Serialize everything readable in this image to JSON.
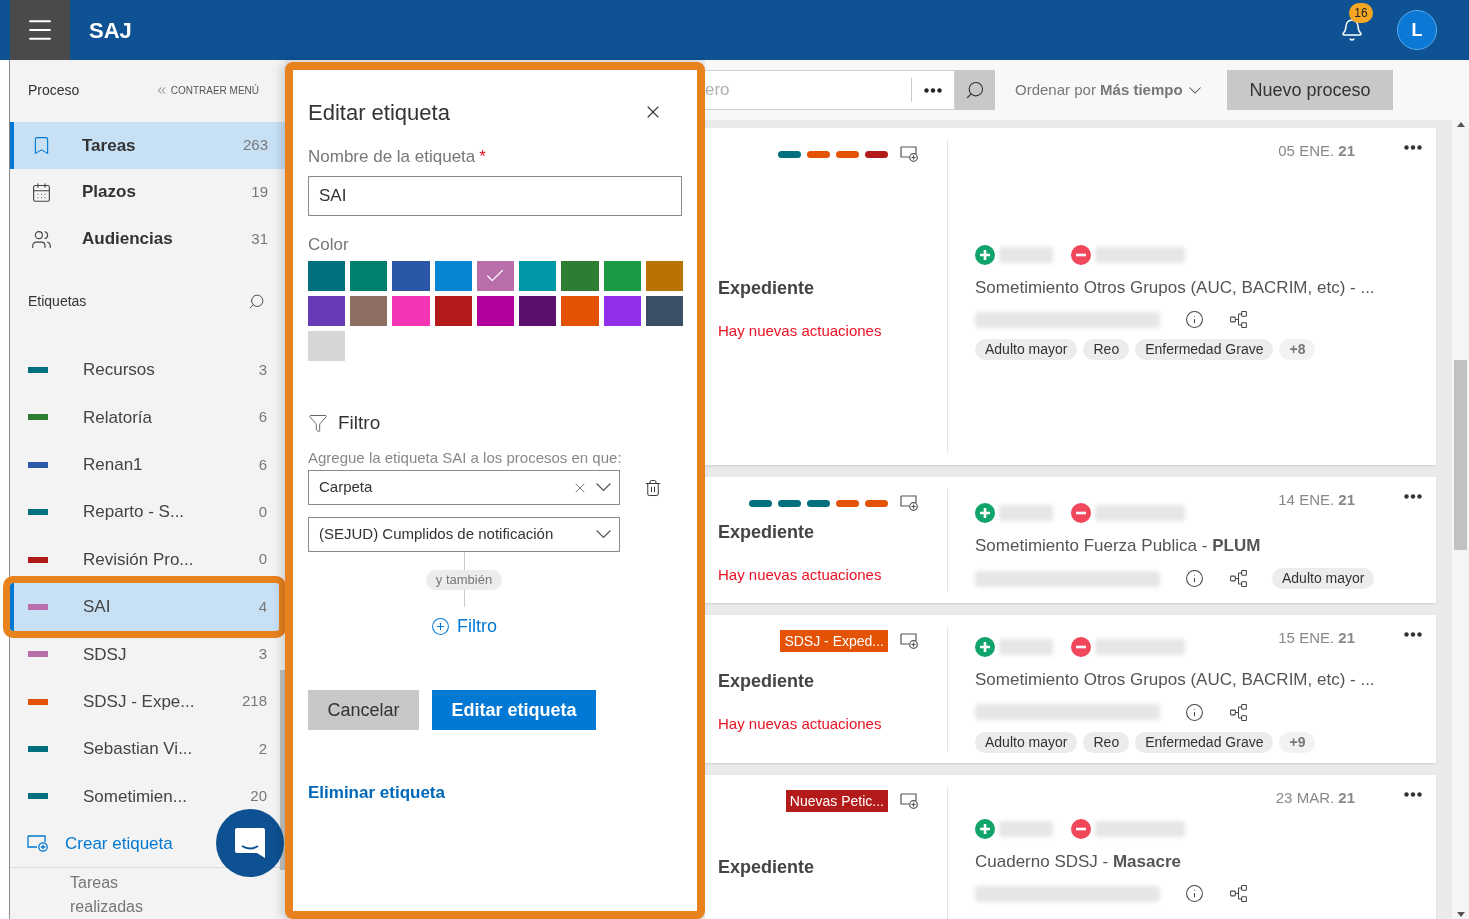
{
  "header": {
    "app_name": "SAJ",
    "notifications": "16",
    "avatar": "L"
  },
  "sidebar": {
    "section_title": "Proceso",
    "collapse": "CONTRAER MENÚ",
    "nav": [
      {
        "label": "Tareas",
        "count": "263",
        "selected": true
      },
      {
        "label": "Plazos",
        "count": "19",
        "selected": false
      },
      {
        "label": "Audiencias",
        "count": "31",
        "selected": false
      }
    ],
    "labels_title": "Etiquetas",
    "labels": [
      {
        "name": "Recursos",
        "count": "3",
        "color": "#00707f",
        "selected": false,
        "annotated": false
      },
      {
        "name": "Relatoría",
        "count": "6",
        "color": "#2e7d32",
        "selected": false,
        "annotated": false
      },
      {
        "name": "Renan1",
        "count": "6",
        "color": "#2b58a6",
        "selected": false,
        "annotated": false
      },
      {
        "name": "Reparto - S...",
        "count": "0",
        "color": "#00707f",
        "selected": false,
        "annotated": false
      },
      {
        "name": "Revisión Pro...",
        "count": "0",
        "color": "#b31b1b",
        "selected": false,
        "annotated": false
      },
      {
        "name": "SAI",
        "count": "4",
        "color": "#b86eab",
        "selected": true,
        "annotated": true
      },
      {
        "name": "SDSJ",
        "count": "3",
        "color": "#b86eab",
        "selected": false,
        "annotated": false
      },
      {
        "name": "SDSJ - Expe...",
        "count": "218",
        "color": "#e35205",
        "selected": false,
        "annotated": false
      },
      {
        "name": "Sebastian Vi...",
        "count": "2",
        "color": "#00707f",
        "selected": false,
        "annotated": false
      },
      {
        "name": "Sometimien...",
        "count": "20",
        "color": "#00707f",
        "selected": false,
        "annotated": false
      }
    ],
    "create_label": "Crear etiqueta",
    "footer": "Tareas realizadas"
  },
  "toolbar": {
    "search_placeholder": "ero",
    "sort": "Ordenar por **Más tiempo**",
    "new_process": "Nuevo proceso"
  },
  "cards": [
    {
      "tags": [
        {
          "color": "#00707f"
        },
        {
          "color": "#e35205"
        },
        {
          "color": "#e35205"
        },
        {
          "color": "#b31b1b"
        }
      ],
      "folder": "Expediente",
      "notice": "Hay nuevas actuaciones",
      "date": "05 ENE. **21**",
      "title": "Sometimiento Otros Grupos (AUC, BACRIM, etc) - ...",
      "chips_inline": false,
      "chips": [
        "Adulto mayor",
        "Reo",
        "Enfermedad Grave"
      ],
      "more": "+8"
    },
    {
      "tags": [
        {
          "color": "#00707f"
        },
        {
          "color": "#00707f"
        },
        {
          "color": "#00707f"
        },
        {
          "color": "#e35205"
        },
        {
          "color": "#e35205"
        }
      ],
      "folder": "Expediente",
      "notice": "Hay nuevas actuaciones",
      "date": "14 ENE. **21**",
      "title": "Sometimiento Fuerza Publica - **PLUM**",
      "chips_inline": true,
      "chips": [
        "Adulto mayor"
      ]
    },
    {
      "label": {
        "text": "SDSJ - Exped...",
        "color": "#e35205"
      },
      "folder": "Expediente",
      "notice": "Hay nuevas actuaciones",
      "date": "15 ENE. **21**",
      "title": "Sometimiento Otros Grupos (AUC, BACRIM, etc) - ...",
      "chips_inline": false,
      "chips": [
        "Adulto mayor",
        "Reo",
        "Enfermedad Grave"
      ],
      "more": "+9"
    },
    {
      "label": {
        "text": "Nuevas Petic...",
        "color": "#b31b1b"
      },
      "folder": "Expediente",
      "date": "23 MAR. **21**",
      "title": "Cuaderno SDSJ - **Masacre**",
      "chips_inline": false
    }
  ],
  "dialog": {
    "title": "Editar etiqueta",
    "name_label": "Nombre de la etiqueta",
    "required_mark": "*",
    "name_value": "SAI",
    "color_label": "Color",
    "colors": [
      {
        "color": "#00707f",
        "selected": false
      },
      {
        "color": "#00806f",
        "selected": false
      },
      {
        "color": "#2b58a6",
        "selected": false
      },
      {
        "color": "#0787d3",
        "selected": false
      },
      {
        "color": "#b86eab",
        "selected": true
      },
      {
        "color": "#0097a7",
        "selected": false
      },
      {
        "color": "#2e7d32",
        "selected": false
      },
      {
        "color": "#1b9a46",
        "selected": false
      },
      {
        "color": "#b87300",
        "selected": false
      },
      {
        "color": "#673ab7",
        "selected": false
      },
      {
        "color": "#8d6e63",
        "selected": false
      },
      {
        "color": "#f436b6",
        "selected": false
      },
      {
        "color": "#b31b1b",
        "selected": false
      },
      {
        "color": "#b1009e",
        "selected": false
      },
      {
        "color": "#5a0f6e",
        "selected": false
      },
      {
        "color": "#e35205",
        "selected": false
      },
      {
        "color": "#9030ea",
        "selected": false
      },
      {
        "color": "#3b5064",
        "selected": false
      },
      {
        "color": "#d6d6d6",
        "selected": false
      }
    ],
    "filter_title": "Filtro",
    "filter_hint": "Agregue la etiqueta SAI a los procesos en que:",
    "filters": [
      {
        "value": "Carpeta",
        "clearable": true,
        "deletable": true
      },
      {
        "value": "(SEJUD) Cumplidos de notificación",
        "clearable": false,
        "deletable": false
      }
    ],
    "connector": "y también",
    "add_filter": "Filtro",
    "cancel": "Cancelar",
    "submit": "Editar etiqueta",
    "delete": "Eliminar etiqueta"
  }
}
